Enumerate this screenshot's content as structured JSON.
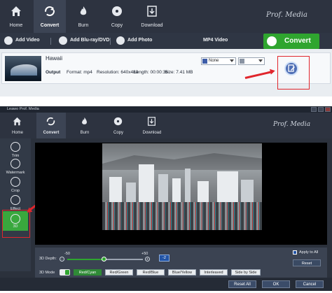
{
  "top": {
    "nav": [
      {
        "label": "Home",
        "icon": "home-icon"
      },
      {
        "label": "Convert",
        "icon": "convert-icon"
      },
      {
        "label": "Burn",
        "icon": "flame-icon"
      },
      {
        "label": "Copy",
        "icon": "disc-icon"
      },
      {
        "label": "Download",
        "icon": "download-icon"
      }
    ],
    "logo": "Prof. Media",
    "toolbar": {
      "add_video": "Add Video",
      "add_bluray": "Add Blu-ray/DVD",
      "add_photo": "Add Photo",
      "output_format": "MP4 Video",
      "convert": "Convert"
    },
    "file": {
      "title": "Hawaii",
      "output_label": "Output",
      "format_label": "Format:",
      "format_value": "mp4",
      "resolution_label": "Resolution:",
      "resolution_value": "640x480",
      "length_label": "Length:",
      "length_value": "00:00:36",
      "size_label": "Size:",
      "size_value": "7.41 MB",
      "subtitle_value": "None"
    }
  },
  "bottom": {
    "window_title": "Leawo Prof. Media",
    "logo": "Prof. Media",
    "nav": [
      {
        "label": "Home"
      },
      {
        "label": "Convert"
      },
      {
        "label": "Burn"
      },
      {
        "label": "Copy"
      },
      {
        "label": "Download"
      }
    ],
    "sidebar": [
      {
        "label": "Trim",
        "icon": "scissors-icon"
      },
      {
        "label": "Watermark",
        "icon": "watermark-icon"
      },
      {
        "label": "Crop",
        "icon": "crop-icon"
      },
      {
        "label": "Effect",
        "icon": "effect-icon"
      },
      {
        "label": "3D",
        "icon": "3d-glasses-icon"
      }
    ],
    "controls": {
      "depth_label": "3D Depth:",
      "depth_min": "-50",
      "depth_max": "+50",
      "depth_value": "-2",
      "depth_level": 0.48,
      "mode_label": "3D Mode",
      "modes": [
        "Red/Cyan",
        "Red/Green",
        "Red/Blue",
        "Blue/Yellow",
        "Interleaved",
        "Side by Side"
      ],
      "selected_mode": "Red/Cyan",
      "apply_all": "Apply to All",
      "reset": "Reset",
      "reset_all": "Reset All",
      "ok": "OK",
      "cancel": "Cancel"
    }
  },
  "colors": {
    "nav_bg": "#2d3340",
    "convert_green": "#2fa52f",
    "highlight_red": "#e0262c",
    "selected_green": "#39a83d"
  }
}
